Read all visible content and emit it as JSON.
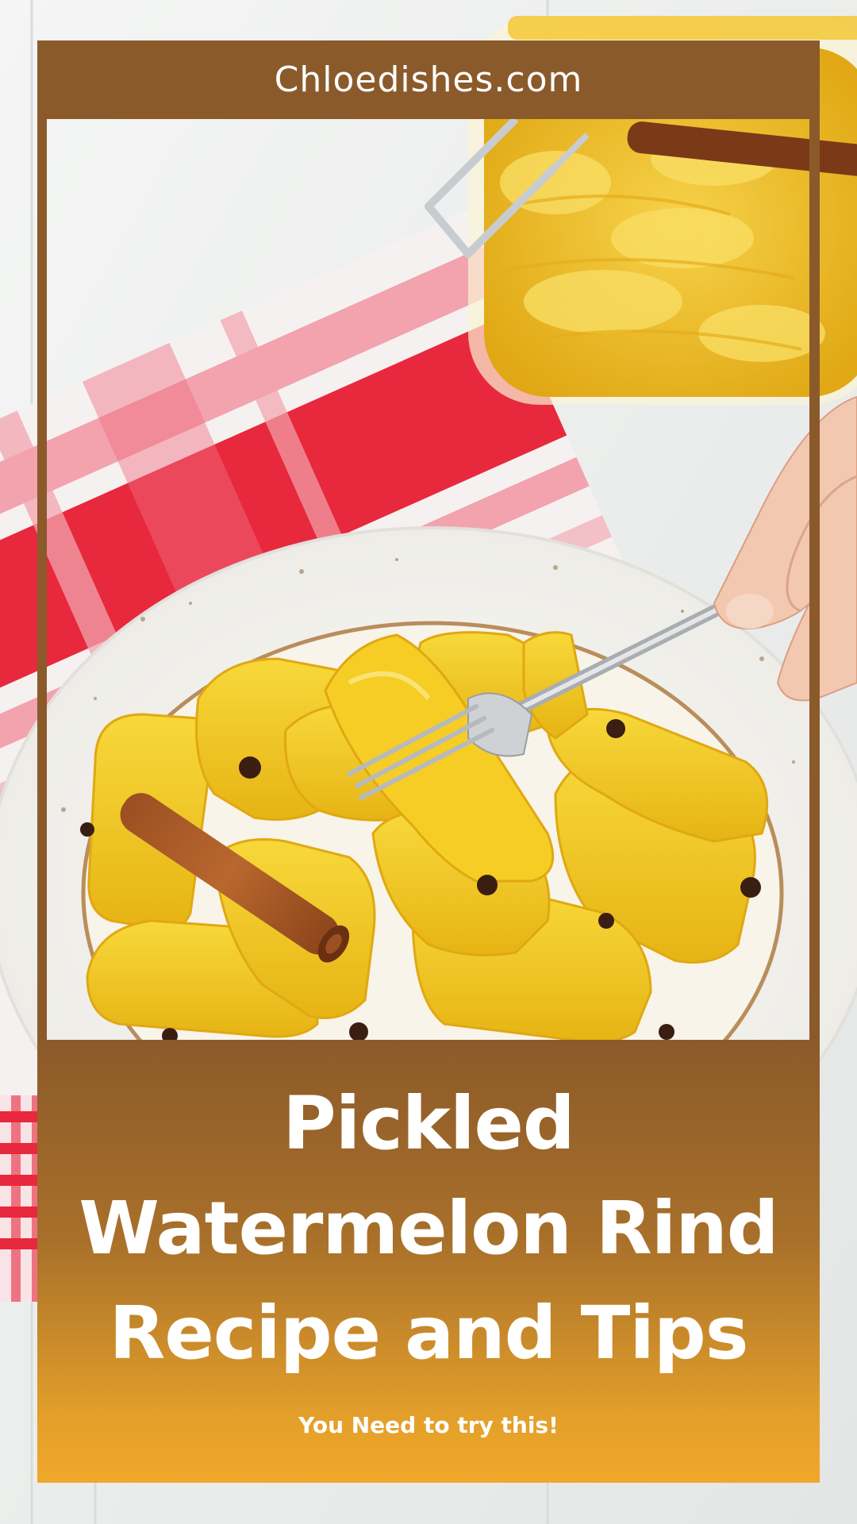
{
  "header": {
    "site_name": "Chloedishes.com"
  },
  "title": {
    "lines": [
      "Pickled",
      "Watermelon Rind",
      "Recipe and Tips"
    ]
  },
  "tagline": "You Need to try this!",
  "colors": {
    "frame_brown": "#8b5a2b",
    "panel_gradient_top": "#8c5a2a",
    "panel_gradient_bottom": "#f0a82a",
    "text": "#ffffff",
    "rind_yellow": "#f2c21c",
    "napkin_red": "#e8283c"
  }
}
